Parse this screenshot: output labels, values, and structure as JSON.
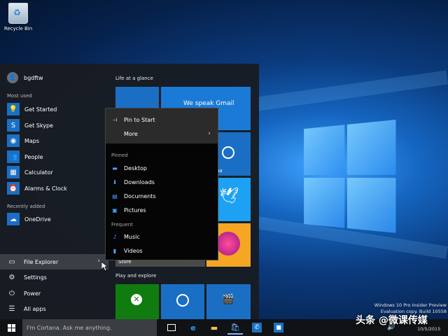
{
  "desktop": {
    "recycle_bin_label": "Recycle Bin",
    "watermark_line1": "Windows 10 Pro Insider Preview",
    "watermark_line2": "Evaluation copy. Build 10558",
    "brand_text": "头条 @微课传媒",
    "clock_date": "10/5/2015"
  },
  "start_menu": {
    "user_name": "bgdftw",
    "most_used_label": "Most used",
    "most_used": [
      {
        "label": "Get Started",
        "icon": "lightbulb-icon",
        "glyph": "💡"
      },
      {
        "label": "Get Skype",
        "icon": "skype-icon",
        "glyph": "S"
      },
      {
        "label": "Maps",
        "icon": "maps-icon",
        "glyph": "◉"
      },
      {
        "label": "People",
        "icon": "people-icon",
        "glyph": "👥"
      },
      {
        "label": "Calculator",
        "icon": "calculator-icon",
        "glyph": "▦"
      },
      {
        "label": "Alarms & Clock",
        "icon": "alarm-clock-icon",
        "glyph": "⏰"
      }
    ],
    "recently_added_label": "Recently added",
    "recently_added": [
      {
        "label": "OneDrive",
        "icon": "onedrive-icon",
        "glyph": "☁"
      }
    ],
    "system": {
      "file_explorer": "File Explorer",
      "settings": "Settings",
      "power": "Power",
      "all_apps": "All apps"
    },
    "tiles": {
      "life_header": "Life at a glance",
      "play_header": "Play and explore",
      "gmail_text": "We speak Gmail",
      "cortana_text": "rtana",
      "store_text": "Store"
    }
  },
  "context_menu": {
    "pin_to_start": "Pin to Start",
    "more": "More",
    "pinned_label": "Pinned",
    "pinned": [
      {
        "label": "Desktop",
        "icon": "desktop-icon",
        "glyph": "▬"
      },
      {
        "label": "Downloads",
        "icon": "download-icon",
        "glyph": "⬇"
      },
      {
        "label": "Documents",
        "icon": "documents-icon",
        "glyph": "▤"
      },
      {
        "label": "Pictures",
        "icon": "pictures-icon",
        "glyph": "▣"
      }
    ],
    "frequent_label": "Frequent",
    "frequent": [
      {
        "label": "Music",
        "icon": "music-icon",
        "glyph": "♪"
      },
      {
        "label": "Videos",
        "icon": "videos-icon",
        "glyph": "▮"
      }
    ]
  },
  "taskbar": {
    "search_placeholder": "I'm Cortana. Ask me anything."
  }
}
